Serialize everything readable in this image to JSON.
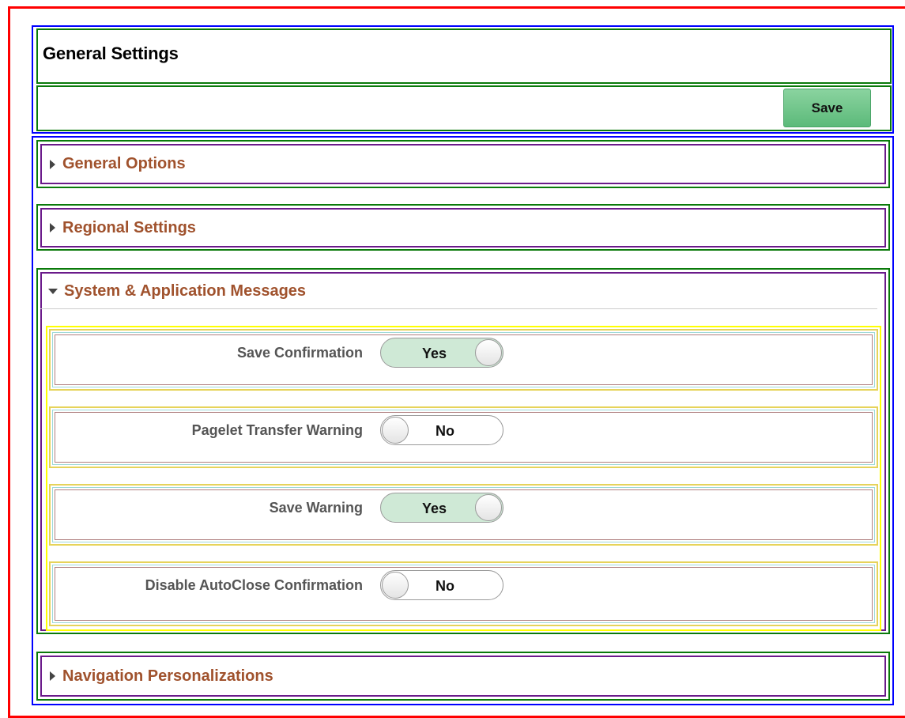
{
  "header": {
    "title": "General Settings",
    "save_label": "Save"
  },
  "sections": {
    "general_options": {
      "label": "General Options",
      "expanded": false
    },
    "regional_settings": {
      "label": "Regional Settings",
      "expanded": false
    },
    "system_messages": {
      "label": "System & Application Messages",
      "expanded": true,
      "fields": [
        {
          "label": "Save Confirmation",
          "value": "Yes"
        },
        {
          "label": "Pagelet Transfer Warning",
          "value": "No"
        },
        {
          "label": "Save Warning",
          "value": "Yes"
        },
        {
          "label": "Disable AutoClose Confirmation",
          "value": "No"
        }
      ]
    },
    "navigation_personalizations": {
      "label": "Navigation Personalizations",
      "expanded": false
    }
  },
  "colors": {
    "section_label": "#a0522d",
    "toggle_on": "#cfe9d6",
    "save_button": "#6cc48a"
  }
}
